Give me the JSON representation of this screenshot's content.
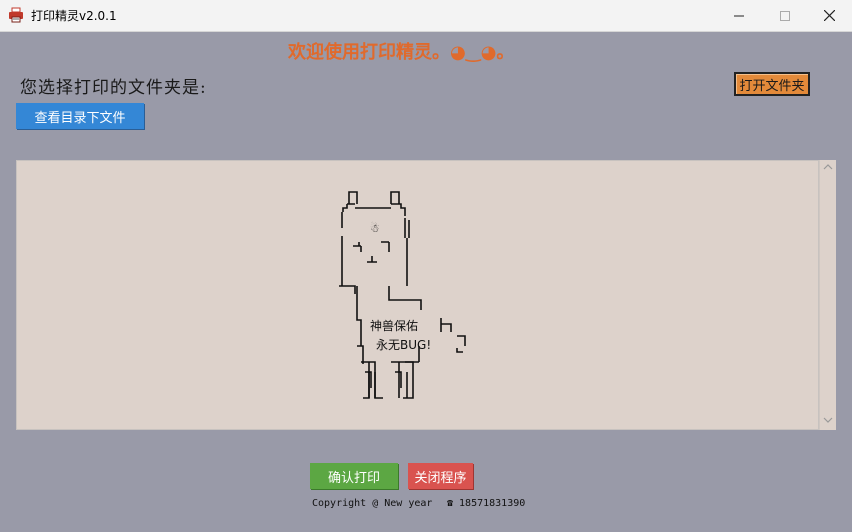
{
  "window": {
    "title": "打印精灵v2.0.1",
    "min_glyph": "—",
    "max_glyph": "☐",
    "close_glyph": "✕"
  },
  "header": {
    "welcome": "欢迎使用打印精灵。◕‿◕。"
  },
  "main": {
    "select_label": "您选择打印的文件夹是:",
    "open_folder_button": "打开文件夹",
    "view_files_button": "查看目录下文件",
    "art_line1": "神兽保佑",
    "art_line2": "永无BUG!",
    "art_head_glyph": "☃",
    "scroll_up": "^",
    "scroll_down": "v"
  },
  "footer": {
    "print_button": "确认打印",
    "close_button": "关闭程序",
    "copyright": "Copyright @ New year",
    "phone": "☎ 18571831390"
  },
  "colors": {
    "background": "#999aa8",
    "welcome": "#e06a2c",
    "open_button": "#e38a3a",
    "view_button": "#3487d6",
    "print_button": "#5ca743",
    "close_button": "#d9534f",
    "text_area": "#ddd2cb"
  },
  "icons": {
    "app": "printer-icon",
    "minimize": "minimize-icon",
    "maximize": "maximize-icon",
    "close": "close-icon"
  }
}
